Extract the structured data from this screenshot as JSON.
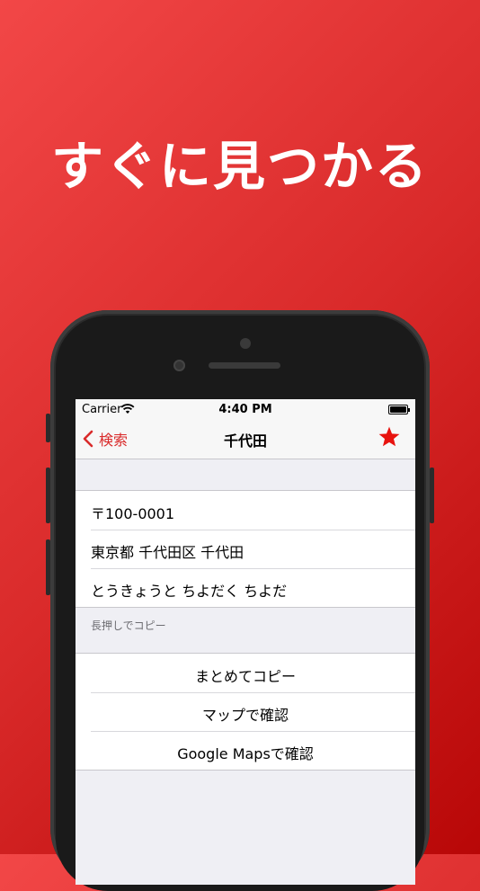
{
  "headline": "すぐに見つかる",
  "status": {
    "carrier": "Carrier",
    "time": "4:40 PM"
  },
  "nav": {
    "back_label": "検索",
    "title": "千代田"
  },
  "info_rows": [
    "〒100-0001",
    "東京都 千代田区 千代田",
    "とうきょうと ちよだく ちよだ"
  ],
  "footer_note": "長押しでコピー",
  "actions": [
    "まとめてコピー",
    "マップで確認",
    "Google Mapsで確認"
  ],
  "colors": {
    "accent": "#d92a2a",
    "background_top": "#f24747",
    "background_bottom": "#b80707"
  },
  "icons": [
    "wifi-icon",
    "battery-icon",
    "chevron-left-icon",
    "star-icon"
  ]
}
